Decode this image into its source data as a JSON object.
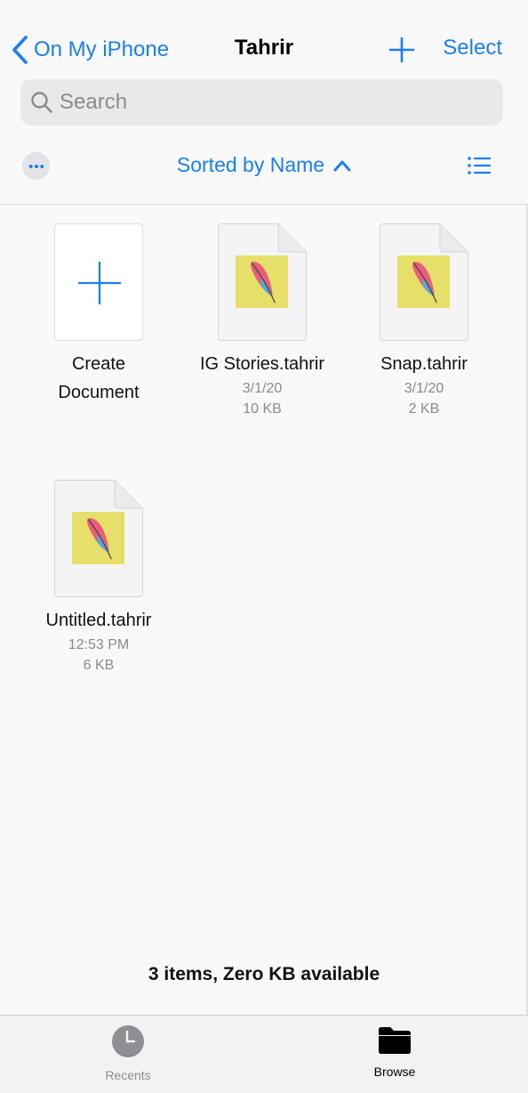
{
  "nav": {
    "back_label": "On My iPhone",
    "title": "Tahrir",
    "select_label": "Select",
    "icons": [
      "chevron-left-icon",
      "plus-icon"
    ]
  },
  "search": {
    "placeholder": "Search",
    "value": ""
  },
  "toolbar": {
    "sort_label": "Sorted by Name",
    "sort_direction": "ascending",
    "icons": [
      "ellipsis-icon",
      "chevron-up-icon",
      "list-view-icon"
    ]
  },
  "create": {
    "line1": "Create",
    "line2": "Document"
  },
  "files": [
    {
      "name": "IG Stories.tahrir",
      "date": "3/1/20",
      "size": "10 KB"
    },
    {
      "name": "Snap.tahrir",
      "date": "3/1/20",
      "size": "2 KB"
    },
    {
      "name": "Untitled.tahrir",
      "date": "12:53 PM",
      "size": "6 KB"
    }
  ],
  "status": "3 items, Zero KB available",
  "tabs": [
    {
      "label": "Recents",
      "icon": "clock-icon",
      "active": false
    },
    {
      "label": "Browse",
      "icon": "folder-icon",
      "active": true
    }
  ],
  "colors": {
    "accent": "#1a7ef5",
    "thumbnail_bg": "#e6df6a",
    "secondary_text": "#8a8a8e",
    "inactive_tab": "#8e8e93"
  }
}
